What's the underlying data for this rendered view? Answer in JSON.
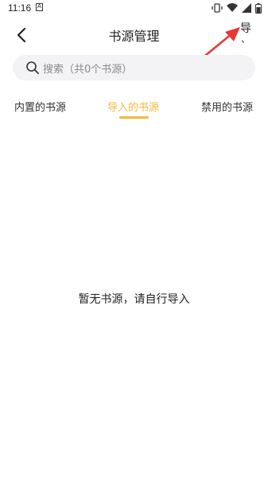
{
  "status_bar": {
    "time": "11:16",
    "a_icon": "A",
    "icons": [
      "vibrate-icon",
      "wifi-icon",
      "signal-icon",
      "battery-icon"
    ]
  },
  "header": {
    "title": "书源管理",
    "import_label": "导",
    "import_sub": "、"
  },
  "search": {
    "placeholder": "搜索（共0个书源）"
  },
  "tabs": [
    {
      "label": "内置的书源",
      "active": false
    },
    {
      "label": "导入的书源",
      "active": true
    },
    {
      "label": "禁用的书源",
      "active": false
    }
  ],
  "empty_state": {
    "message": "暂无书源，请自行导入"
  },
  "colors": {
    "accent": "#f5b83b",
    "annotation": "#e53935",
    "search_bg": "#f3f3f5"
  }
}
